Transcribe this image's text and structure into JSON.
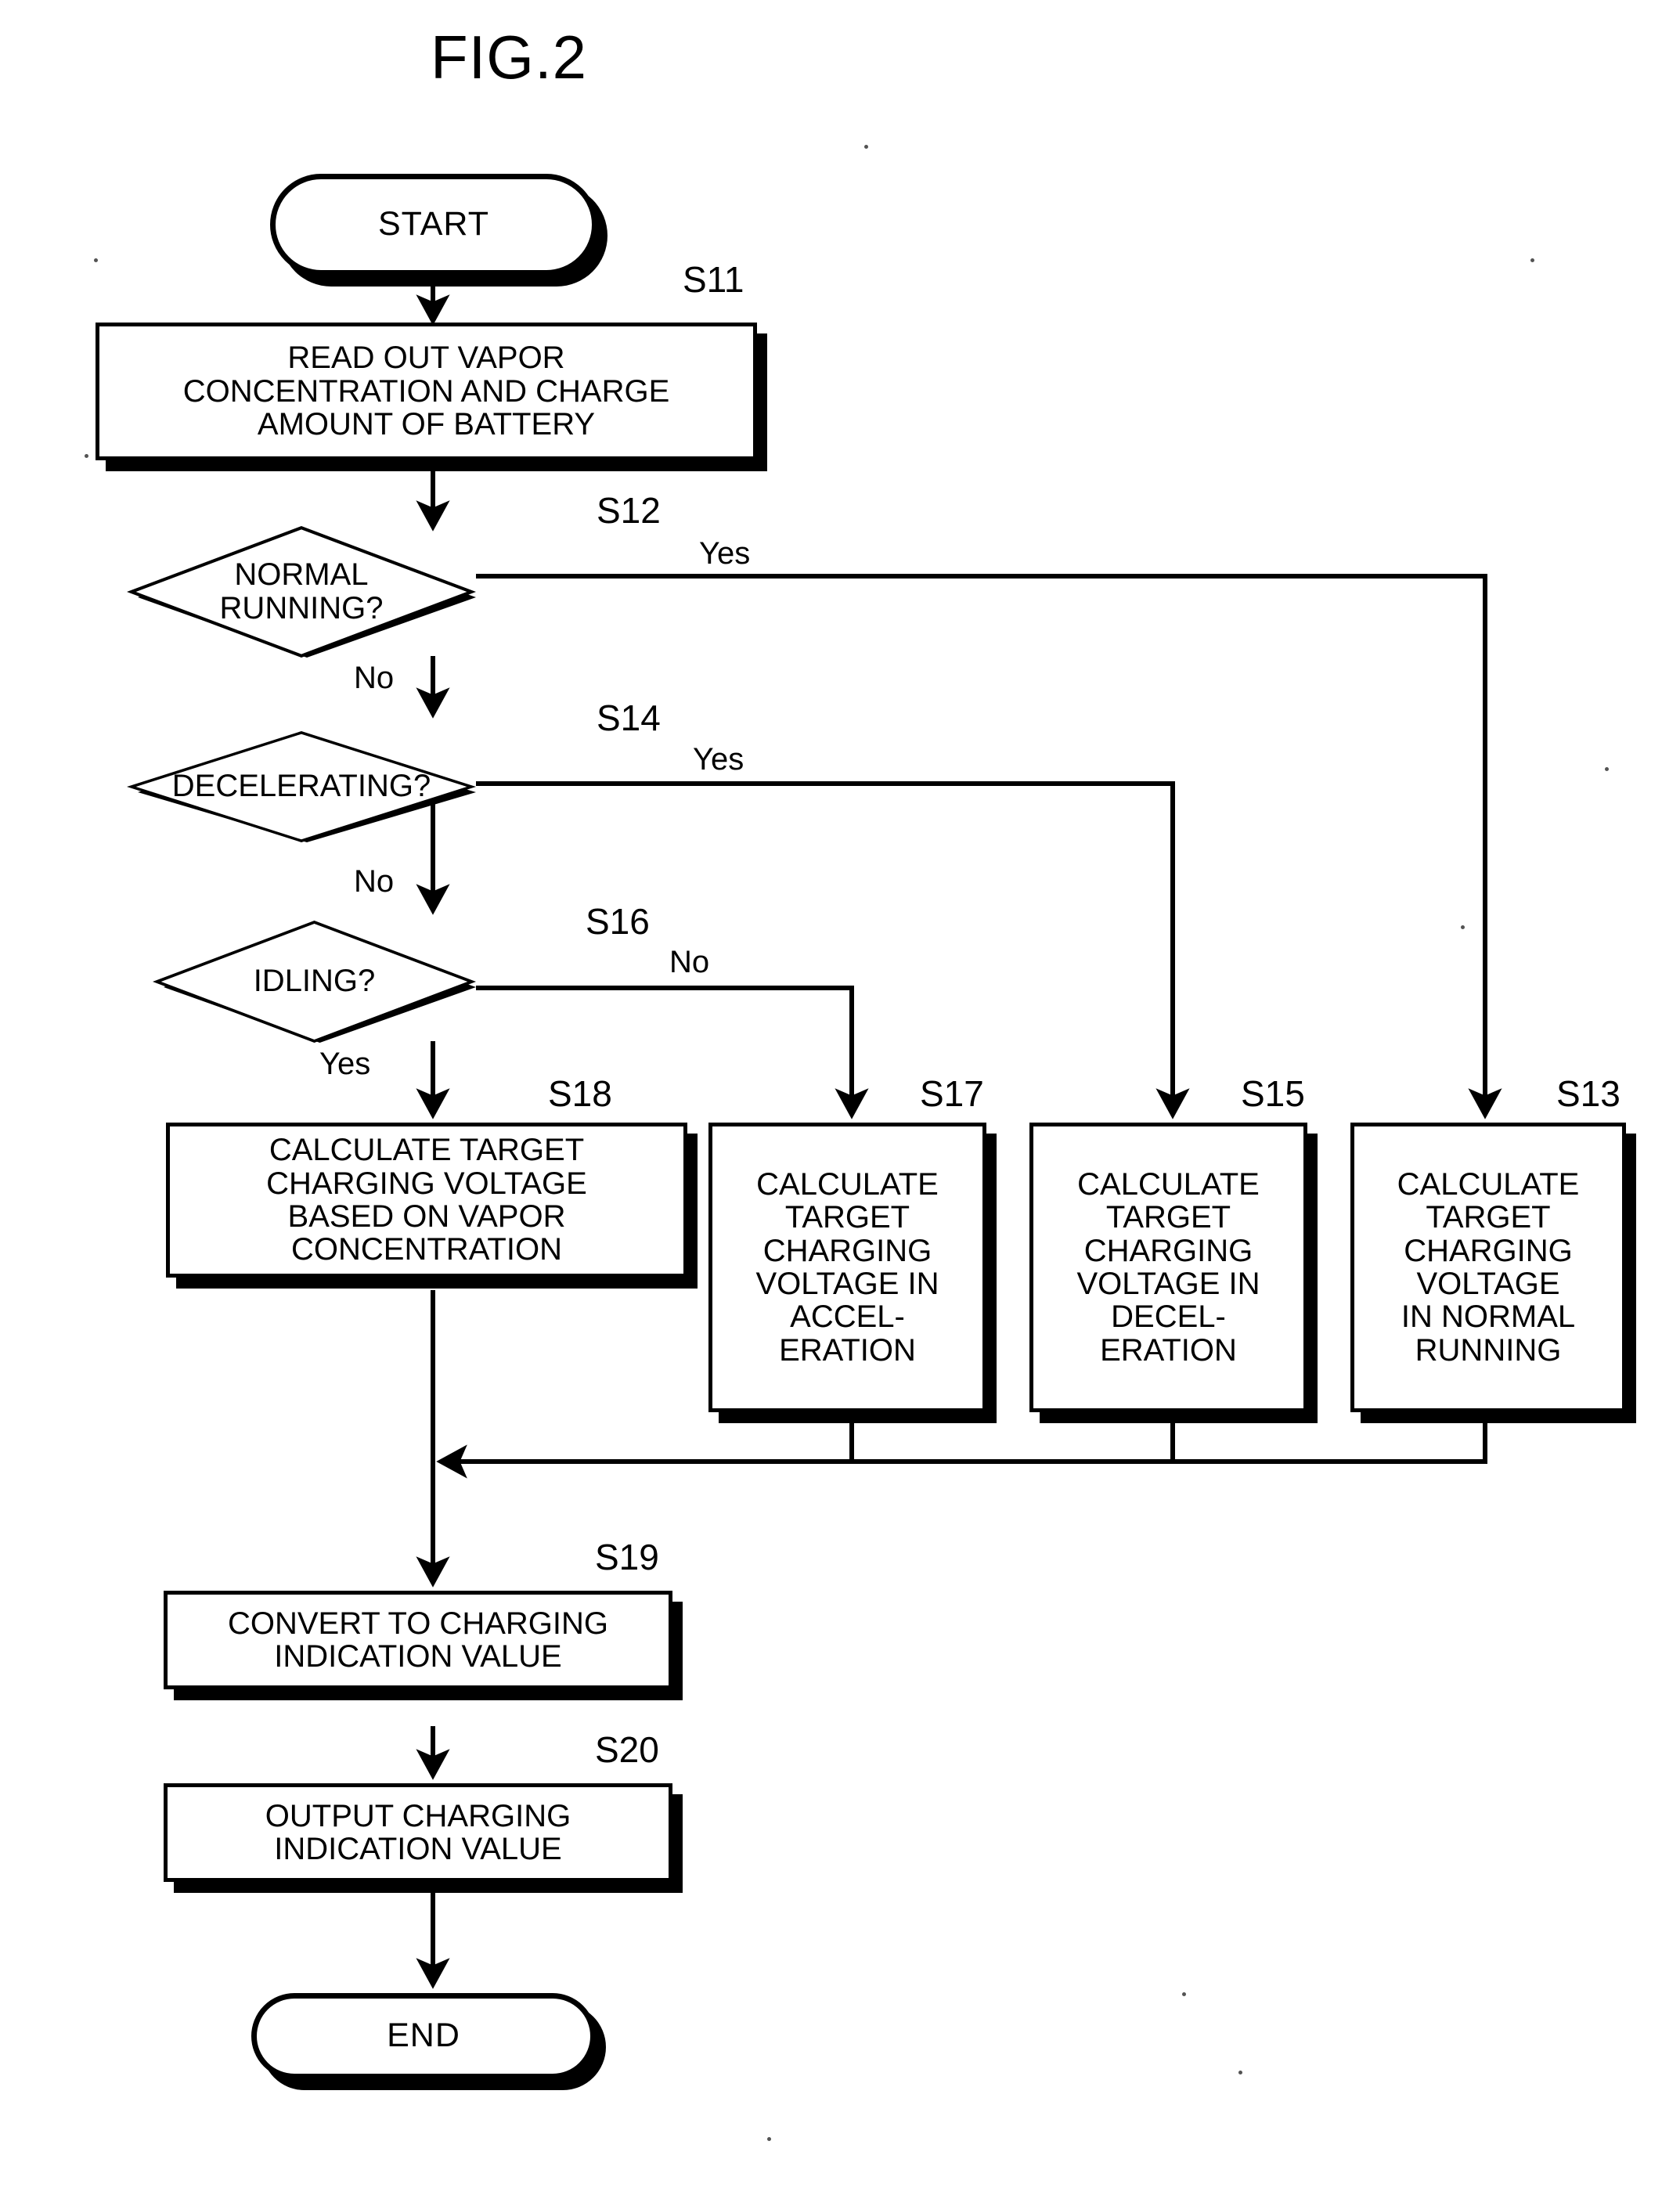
{
  "figure": {
    "title": "FIG.2",
    "type": "process-flowchart"
  },
  "nodes": {
    "start": {
      "label": "START",
      "shape": "terminal"
    },
    "end": {
      "label": "END",
      "shape": "terminal"
    },
    "s11": {
      "step": "S11",
      "shape": "process",
      "label": "READ OUT VAPOR\nCONCENTRATION AND CHARGE\nAMOUNT OF BATTERY"
    },
    "s12": {
      "step": "S12",
      "shape": "decision",
      "label": "NORMAL\nRUNNING?"
    },
    "s13": {
      "step": "S13",
      "shape": "process",
      "label": "CALCULATE\nTARGET\nCHARGING\nVOLTAGE\nIN NORMAL\nRUNNING"
    },
    "s14": {
      "step": "S14",
      "shape": "decision",
      "label": "DECELERATING?"
    },
    "s15": {
      "step": "S15",
      "shape": "process",
      "label": "CALCULATE\nTARGET\nCHARGING\nVOLTAGE IN\nDECEL-\nERATION"
    },
    "s16": {
      "step": "S16",
      "shape": "decision",
      "label": "IDLING?"
    },
    "s17": {
      "step": "S17",
      "shape": "process",
      "label": "CALCULATE\nTARGET\nCHARGING\nVOLTAGE IN\nACCEL-\nERATION"
    },
    "s18": {
      "step": "S18",
      "shape": "process",
      "label": "CALCULATE TARGET\nCHARGING VOLTAGE\nBASED ON VAPOR\nCONCENTRATION"
    },
    "s19": {
      "step": "S19",
      "shape": "process",
      "label": "CONVERT TO CHARGING\nINDICATION VALUE"
    },
    "s20": {
      "step": "S20",
      "shape": "process",
      "label": "OUTPUT CHARGING\nINDICATION VALUE"
    }
  },
  "branches": {
    "s12_yes": "Yes",
    "s12_no": "No",
    "s14_yes": "Yes",
    "s14_no": "No",
    "s16_no": "No",
    "s16_yes": "Yes"
  },
  "colors": {
    "ink": "#000000",
    "paper": "#ffffff"
  }
}
